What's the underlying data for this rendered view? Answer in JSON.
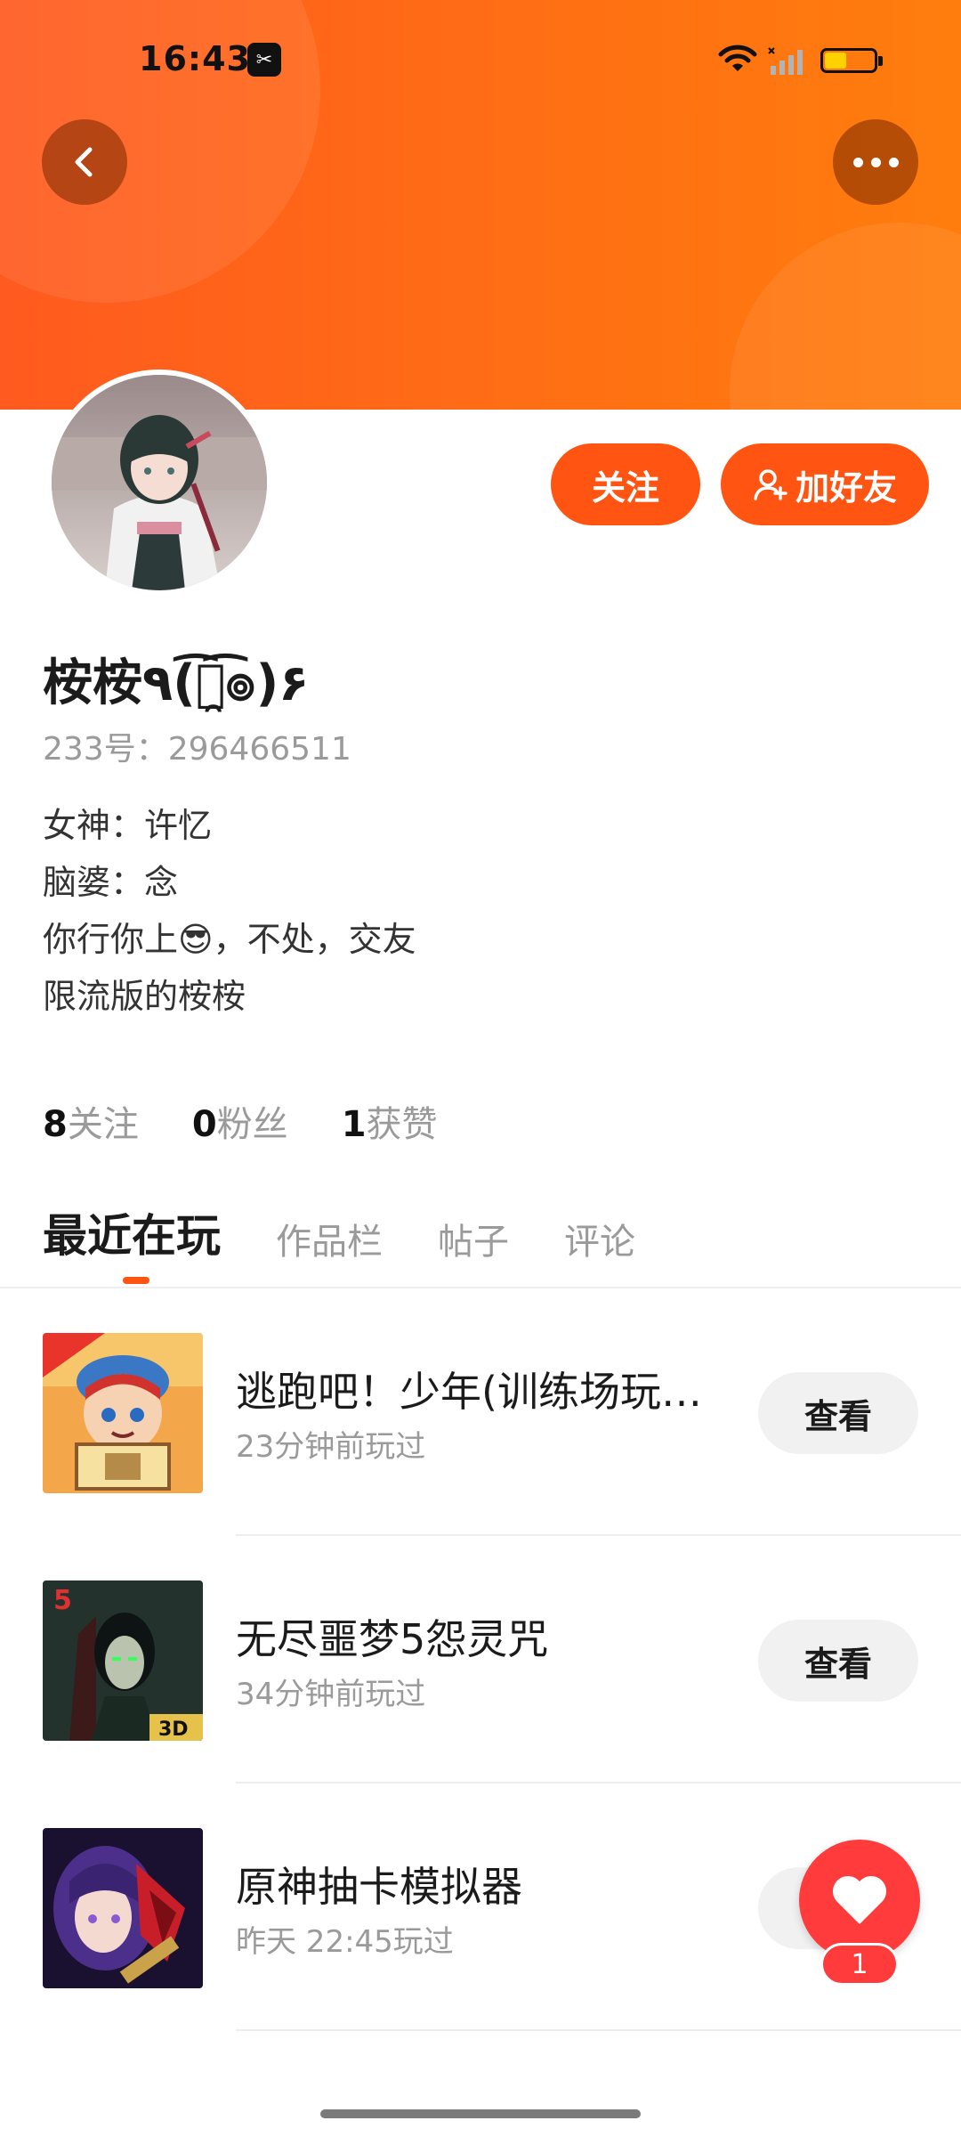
{
  "status_bar": {
    "time": "16:43"
  },
  "header": {
    "back_icon": "chevron-left-icon",
    "more_icon": "more-horizontal-icon"
  },
  "profile": {
    "name": "桉桉٩(͡๏̯͡๏)۶",
    "id_text": "233号：296466511",
    "bio": [
      "女神：许忆",
      "脑婆：念",
      "你行你上😎，不处，交友",
      "限流版的桉桉"
    ],
    "follow_label": "关注",
    "add_friend_label": "加好友"
  },
  "stats": [
    {
      "num": "8",
      "label": "关注"
    },
    {
      "num": "0",
      "label": "粉丝"
    },
    {
      "num": "1",
      "label": "获赞"
    }
  ],
  "tabs": [
    "最近在玩",
    "作品栏",
    "帖子",
    "评论"
  ],
  "games": [
    {
      "title": "逃跑吧！少年(训练场玩…",
      "time": "23分钟前玩过",
      "button": "查看"
    },
    {
      "title": "无尽噩梦5怨灵咒",
      "time": "34分钟前玩过",
      "button": "查看"
    },
    {
      "title": "原神抽卡模拟器",
      "time": "昨天 22:45玩过",
      "button": "查看"
    }
  ],
  "like": {
    "count": "1"
  },
  "colors": {
    "accent": "#ff5412",
    "like": "#ff3b3b"
  }
}
